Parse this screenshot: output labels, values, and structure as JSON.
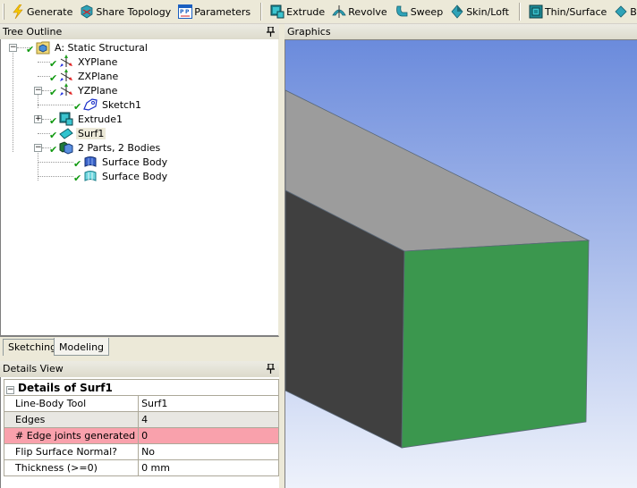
{
  "toolbar": {
    "items": [
      {
        "label": "Generate",
        "icon": "lightning-bolt-icon"
      },
      {
        "label": "Share Topology",
        "icon": "share-topology-icon"
      },
      {
        "label": "Parameters",
        "icon": "parameters-icon"
      },
      {
        "label": "Extrude",
        "icon": "extrude-icon"
      },
      {
        "label": "Revolve",
        "icon": "revolve-icon"
      },
      {
        "label": "Sweep",
        "icon": "sweep-icon"
      },
      {
        "label": "Skin/Loft",
        "icon": "skin-loft-icon"
      },
      {
        "label": "Thin/Surface",
        "icon": "thin-surface-icon"
      },
      {
        "label": "Blend",
        "icon": "blend-icon"
      }
    ]
  },
  "tree_outline": {
    "title": "Tree Outline",
    "items": [
      {
        "label": "A: Static Structural",
        "icon": "static-structural-icon",
        "expander": "−",
        "status": "check"
      },
      {
        "label": "XYPlane",
        "icon": "plane-axes-icon",
        "status": "check"
      },
      {
        "label": "ZXPlane",
        "icon": "plane-axes-icon",
        "status": "check"
      },
      {
        "label": "YZPlane",
        "icon": "plane-axes-icon",
        "expander": "−",
        "status": "check"
      },
      {
        "label": "Sketch1",
        "icon": "sketch-icon",
        "status": "check"
      },
      {
        "label": "Extrude1",
        "icon": "extrude-icon",
        "expander": "+",
        "status": "check"
      },
      {
        "label": "Surf1",
        "icon": "surface-icon",
        "status": "check",
        "selected": true
      },
      {
        "label": "2 Parts, 2 Bodies",
        "icon": "parts-bodies-icon",
        "expander": "−",
        "status": "check"
      },
      {
        "label": "Surface Body",
        "icon": "surface-body-icon",
        "status": "check"
      },
      {
        "label": "Surface Body",
        "icon": "surface-body-light-icon",
        "status": "check"
      }
    ]
  },
  "tabs": [
    {
      "label": "Sketching",
      "active": false
    },
    {
      "label": "Modeling",
      "active": true
    }
  ],
  "details_view": {
    "title": "Details View",
    "group": "Details of Surf1",
    "rows": [
      {
        "name": "Line-Body Tool",
        "value": "Surf1",
        "style": "normal"
      },
      {
        "name": "Edges",
        "value": "4",
        "style": "readonly"
      },
      {
        "name": "# Edge joints generated",
        "value": "0",
        "style": "highlight"
      },
      {
        "name": "Flip Surface Normal?",
        "value": "No",
        "style": "normal"
      },
      {
        "name": "Thickness (>=0)",
        "value": "0 mm",
        "style": "normal"
      }
    ]
  },
  "graphics": {
    "title": "Graphics",
    "colors": {
      "background_top": "#6b8bdc",
      "background_bottom": "#eef2fb",
      "top_face": "#9c9c9c",
      "side_face": "#404040",
      "selected_face": "#3b974e",
      "edge": "#5a6878"
    }
  },
  "pin_glyph": "ꟼ"
}
